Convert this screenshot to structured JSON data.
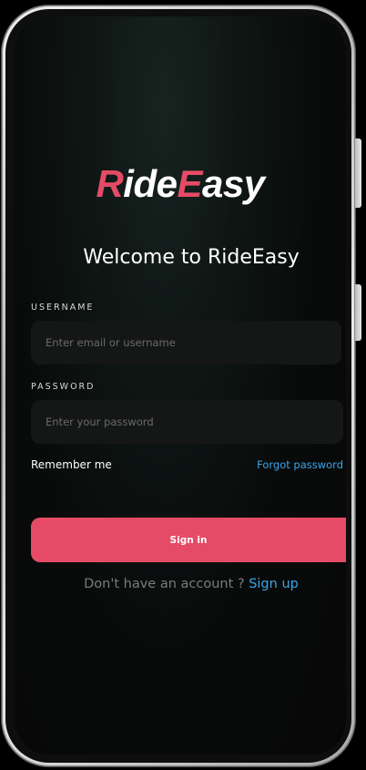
{
  "app": {
    "logo_part1_accent": "R",
    "logo_part2": "ide",
    "logo_part3_accent": "E",
    "logo_part4": "asy",
    "accent_color": "#e54b66",
    "link_color": "#3aa5e8"
  },
  "welcome": {
    "title": "Welcome to RideEasy"
  },
  "form": {
    "username_label": "USERNAME",
    "username_placeholder": "Enter email or username",
    "password_label": "PASSWORD",
    "password_placeholder": "Enter your password",
    "remember_label": "Remember me",
    "forgot_label": "Forgot password",
    "signin_label": "Sign in"
  },
  "signup": {
    "prompt": "Don't have an account ? ",
    "link": "Sign up"
  }
}
